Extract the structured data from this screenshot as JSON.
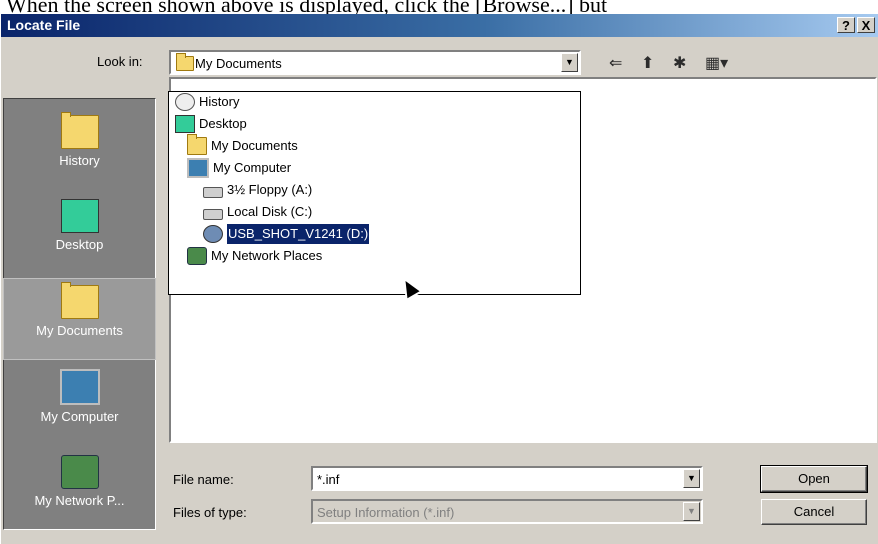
{
  "background_text": "When the screen shown above is displayed, click the [Browse...] but",
  "window": {
    "title": "Locate File",
    "help_label": "?",
    "close_label": "X"
  },
  "look_in": {
    "label": "Look in:",
    "value": "My Documents"
  },
  "dropdown_items": [
    {
      "label": "History",
      "icon": "history-icon"
    },
    {
      "label": "Desktop",
      "icon": "desktop-icon"
    },
    {
      "label": "My Documents",
      "icon": "my-documents-icon"
    },
    {
      "label": "My Computer",
      "icon": "my-computer-icon"
    },
    {
      "label": "3½ Floppy (A:)",
      "icon": "floppy-icon"
    },
    {
      "label": "Local Disk (C:)",
      "icon": "hard-disk-icon"
    },
    {
      "label": "USB_SHOT_V1241 (D:)",
      "icon": "usb-drive-icon",
      "selected": true
    },
    {
      "label": "My Network Places",
      "icon": "network-places-icon"
    }
  ],
  "places": [
    {
      "label": "History",
      "icon": "history-icon"
    },
    {
      "label": "Desktop",
      "icon": "desktop-icon"
    },
    {
      "label": "My Documents",
      "icon": "my-documents-icon",
      "selected": true
    },
    {
      "label": "My Computer",
      "icon": "my-computer-icon"
    },
    {
      "label": "My Network P...",
      "icon": "network-places-icon"
    }
  ],
  "file_name": {
    "label": "File name:",
    "value": "*.inf"
  },
  "files_of_type": {
    "label": "Files of type:",
    "value": "Setup Information (*.inf)"
  },
  "buttons": {
    "open": "Open",
    "cancel": "Cancel"
  },
  "toolbar": {
    "back_icon": "back-arrow-icon",
    "up_icon": "up-folder-icon",
    "new_folder_icon": "new-folder-icon",
    "views_icon": "view-menu-icon"
  },
  "colors": {
    "title_gradient_start": "#0a246a",
    "title_gradient_end": "#a6caf0",
    "selection": "#0a246a",
    "face": "#d4d0c8"
  }
}
